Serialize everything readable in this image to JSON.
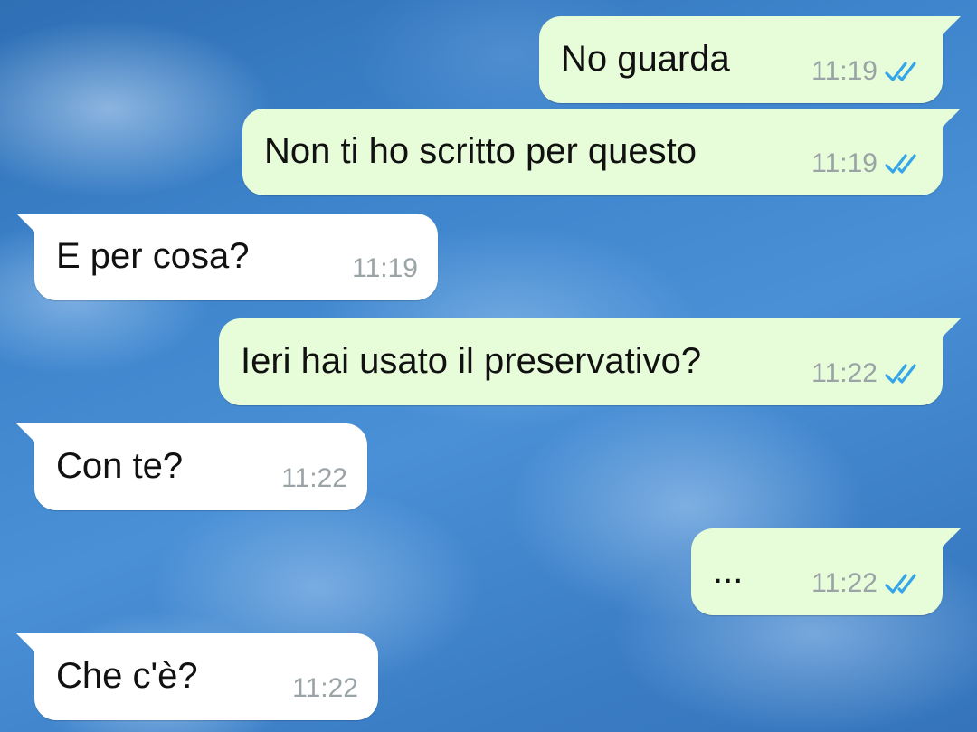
{
  "chat": {
    "messages": [
      {
        "direction": "out",
        "text": "No guarda",
        "time": "11:19",
        "status": "read"
      },
      {
        "direction": "out",
        "text": "Non ti ho scritto per questo",
        "time": "11:19",
        "status": "read"
      },
      {
        "direction": "in",
        "text": "E per cosa?",
        "time": "11:19"
      },
      {
        "direction": "out",
        "text": "Ieri hai usato il preservativo?",
        "time": "11:22",
        "status": "read"
      },
      {
        "direction": "in",
        "text": "Con te?",
        "time": "11:22"
      },
      {
        "direction": "out",
        "text": "...",
        "time": "11:22",
        "status": "read"
      },
      {
        "direction": "in",
        "text": "Che c'è?",
        "time": "11:22"
      }
    ]
  },
  "colors": {
    "outgoing_bubble": "#e7fdd9",
    "incoming_bubble": "#ffffff",
    "read_ticks": "#34a5e8",
    "timestamp": "#9aa3a6"
  },
  "icons": {
    "read_status": "double-check-icon"
  }
}
